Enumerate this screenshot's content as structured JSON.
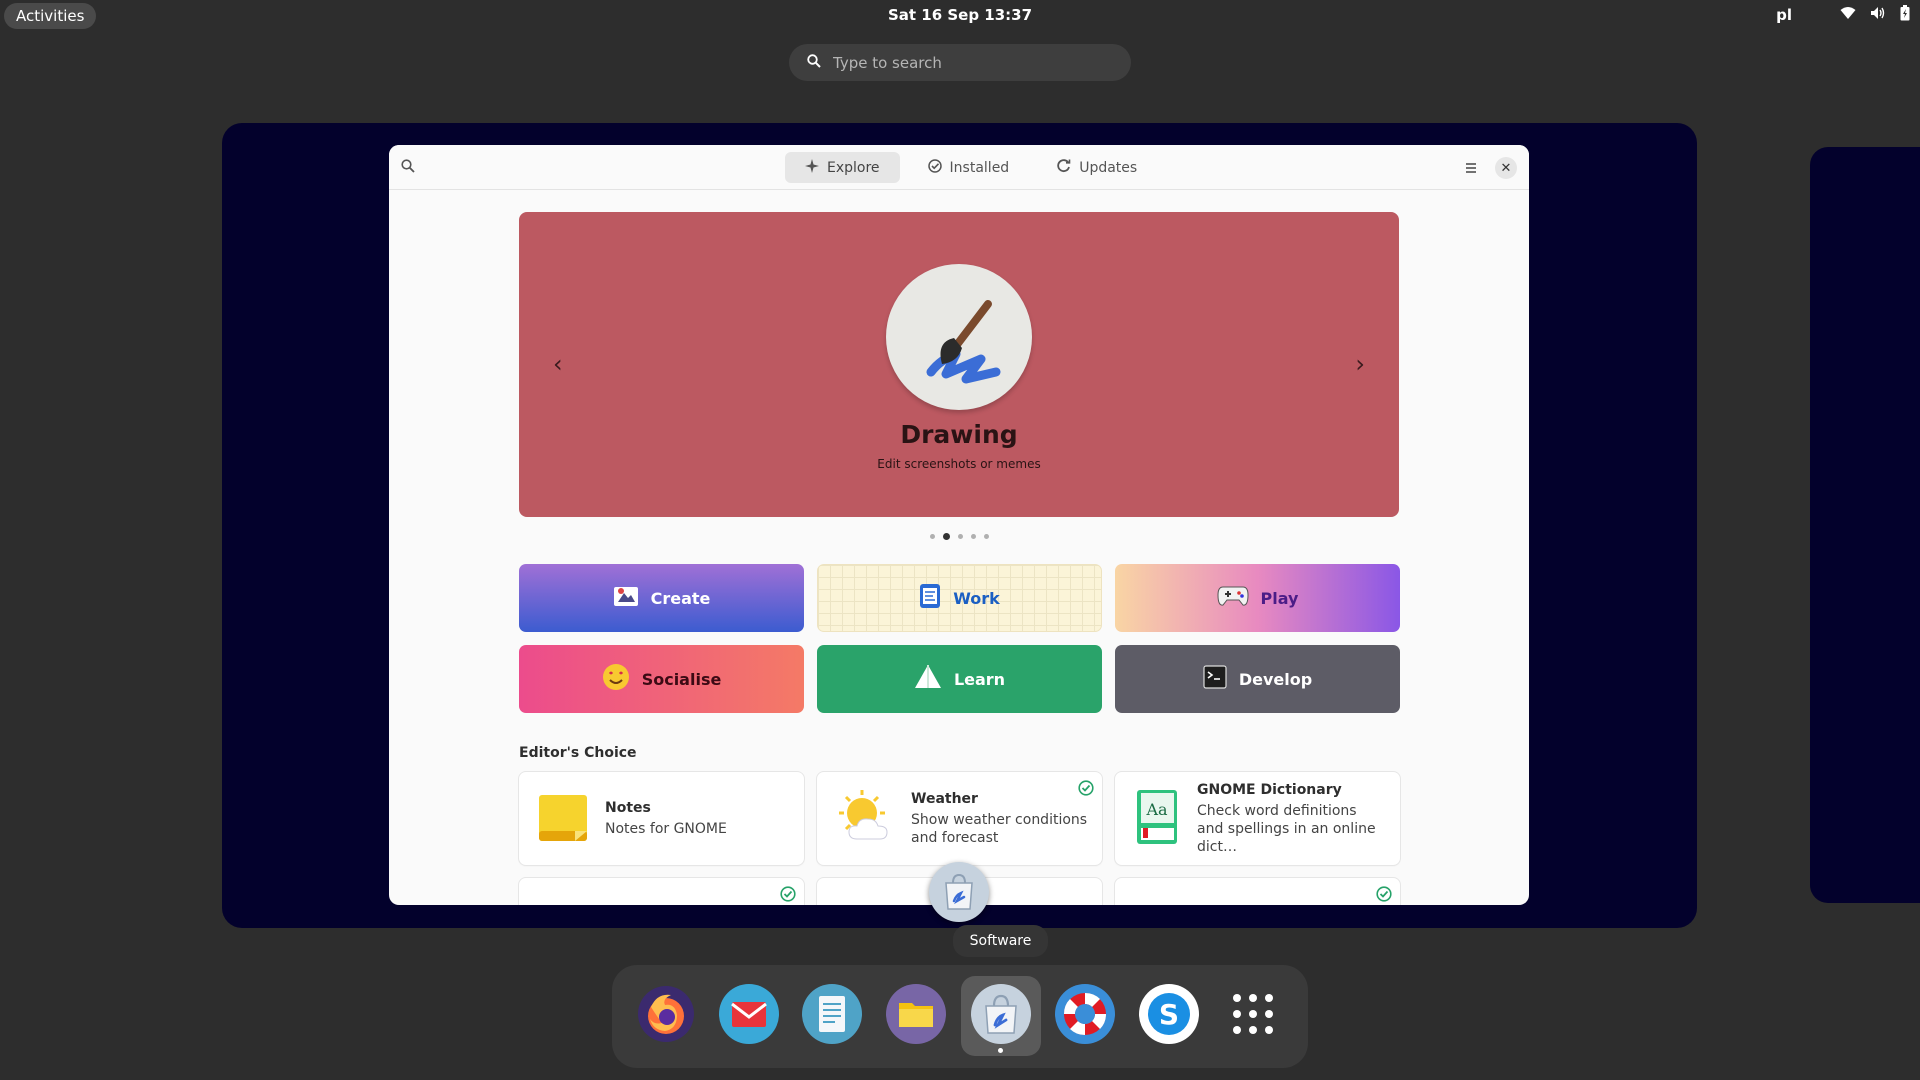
{
  "topbar": {
    "activities": "Activities",
    "clock": "Sat 16 Sep  13:37",
    "keyboard_layout": "pl",
    "icons": [
      "wifi-icon",
      "volume-icon",
      "battery-icon"
    ]
  },
  "overview_search": {
    "placeholder": "Type to search"
  },
  "window": {
    "tabs": [
      {
        "label": "Explore",
        "icon": "sparkle-icon",
        "active": true
      },
      {
        "label": "Installed",
        "icon": "check-circle-icon",
        "active": false
      },
      {
        "label": "Updates",
        "icon": "refresh-icon",
        "active": false
      }
    ],
    "close": "✕"
  },
  "banner": {
    "title": "Drawing",
    "subtitle": "Edit screenshots or memes",
    "prev": "‹",
    "next": "›",
    "page_count": 5,
    "active_page": 2,
    "color": "#bc5961"
  },
  "categories": [
    {
      "label": "Create",
      "icon": "create-icon"
    },
    {
      "label": "Work",
      "icon": "work-icon"
    },
    {
      "label": "Play",
      "icon": "gamepad-icon"
    },
    {
      "label": "Socialise",
      "icon": "emoji-icon"
    },
    {
      "label": "Learn",
      "icon": "sail-icon"
    },
    {
      "label": "Develop",
      "icon": "terminal-icon"
    }
  ],
  "editors_choice": {
    "title": "Editor's Choice",
    "apps": [
      {
        "name": "Notes",
        "desc": "Notes for GNOME",
        "icon": "notes-icon",
        "installed": false
      },
      {
        "name": "Weather",
        "desc": "Show weather conditions and forecast",
        "icon": "weather-icon",
        "installed": true
      },
      {
        "name": "GNOME Dictionary",
        "desc": "Check word definitions and spellings in an online dict…",
        "icon": "dictionary-icon",
        "installed": false
      }
    ]
  },
  "tooltip": "Software",
  "dock": {
    "apps": [
      "firefox-icon",
      "mail-icon",
      "text-editor-icon",
      "files-icon",
      "software-icon",
      "help-icon",
      "skype-icon",
      "app-grid-icon"
    ],
    "active_app": "software-icon"
  },
  "colors": {
    "workspace": "#03012c",
    "create": "#3c5cd0",
    "learn": "#2aa36a",
    "develop": "#5d5c66"
  }
}
